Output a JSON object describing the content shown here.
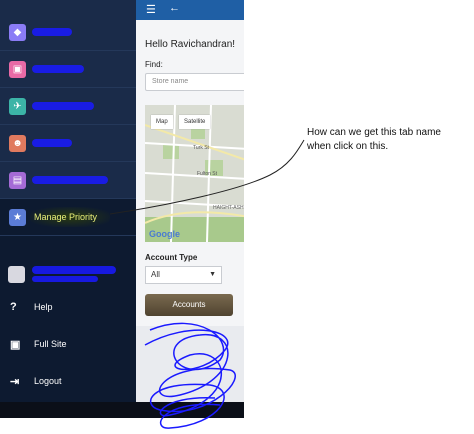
{
  "sidebar": {
    "items": [
      {
        "label": "",
        "icon": "diamond-icon",
        "color": "#8b7cf6"
      },
      {
        "label": "",
        "icon": "calendar-icon",
        "color": "#e86aa6"
      },
      {
        "label": "",
        "icon": "airplane-icon",
        "color": "#3cb4a7"
      },
      {
        "label": "",
        "icon": "user-icon",
        "color": "#e07a5f"
      },
      {
        "label": "",
        "icon": "document-icon",
        "color": "#a56bd6"
      },
      {
        "label": "Manage Priority",
        "icon": "star-icon",
        "color": "#5b7cd6"
      }
    ],
    "lower_items": [
      {
        "label": "Help",
        "icon": "question-icon"
      },
      {
        "label": "Full Site",
        "icon": "full-site-icon"
      },
      {
        "label": "Logout",
        "icon": "logout-icon"
      }
    ]
  },
  "app": {
    "greeting": "Hello Ravichandran!",
    "find_label": "Find:",
    "store_placeholder": "Store name",
    "map_tabs": [
      "Map",
      "Satellite"
    ],
    "map_labels": [
      "Turk St",
      "Fulton St",
      "HAIGHT-ASH"
    ],
    "map_brand": "Google",
    "account_type_label": "Account Type",
    "account_type_value": "All",
    "accounts_button": "Accounts"
  },
  "annotation": {
    "text": "How can we get this tab name when click on this."
  }
}
